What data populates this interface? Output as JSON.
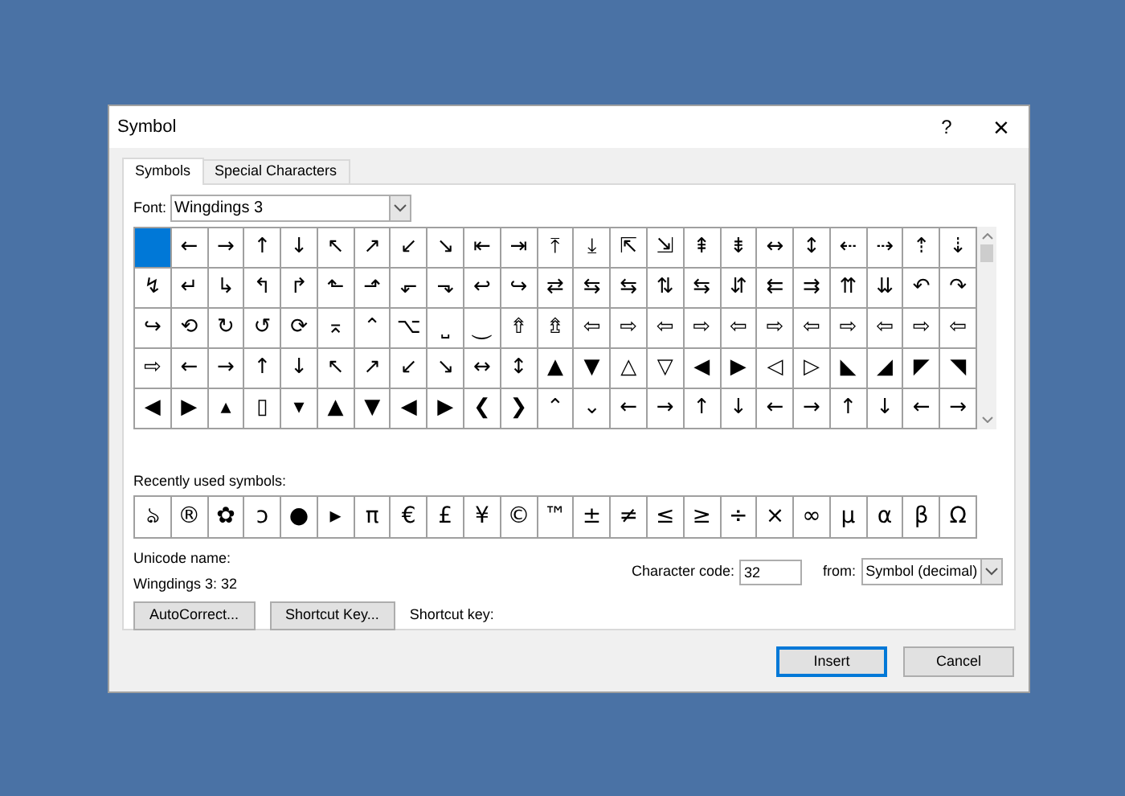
{
  "window": {
    "title": "Symbol",
    "help": "?",
    "close": "×"
  },
  "tabs": [
    {
      "label": "Symbols",
      "selected": true
    },
    {
      "label": "Special Characters",
      "selected": false
    }
  ],
  "font": {
    "label": "Font:",
    "value": "Wingdings 3"
  },
  "grid": {
    "rows": [
      [
        {
          "selected": true
        },
        {
          "symbol": "←",
          "selected": false
        },
        {
          "symbol": "→",
          "selected": false
        },
        {
          "symbol": "↑",
          "selected": false
        },
        {
          "symbol": "↓",
          "selected": false
        },
        {
          "symbol": "↖",
          "selected": false
        },
        {
          "symbol": "↗",
          "selected": false
        },
        {
          "symbol": "↙",
          "selected": false
        },
        {
          "symbol": "↘",
          "selected": false
        },
        {
          "symbol": "⇤",
          "selected": false
        },
        {
          "symbol": "⇥",
          "selected": false
        },
        {
          "symbol": "⤒",
          "selected": false
        },
        {
          "symbol": "⤓",
          "selected": false
        },
        {
          "symbol": "⇱",
          "selected": false
        },
        {
          "symbol": "⇲",
          "selected": false
        },
        {
          "symbol": "⇞",
          "selected": false
        },
        {
          "symbol": "⇟",
          "selected": false
        },
        {
          "symbol": "↔",
          "selected": false
        },
        {
          "symbol": "↕",
          "selected": false
        },
        {
          "symbol": "⇠",
          "selected": false
        },
        {
          "symbol": "⇢",
          "selected": false
        },
        {
          "symbol": "⇡",
          "selected": false
        },
        {
          "symbol": "⇣",
          "selected": false
        }
      ],
      [
        {
          "symbol": "↯",
          "selected": false
        },
        {
          "symbol": "↵",
          "selected": false
        },
        {
          "symbol": "↳",
          "selected": false
        },
        {
          "symbol": "↰",
          "selected": false
        },
        {
          "symbol": "↱",
          "selected": false
        },
        {
          "symbol": "⬑",
          "selected": false
        },
        {
          "symbol": "⬏",
          "selected": false
        },
        {
          "symbol": "⬐",
          "selected": false
        },
        {
          "symbol": "⬎",
          "selected": false
        },
        {
          "symbol": "↩",
          "selected": false
        },
        {
          "symbol": "↪",
          "selected": false
        },
        {
          "symbol": "⇄",
          "selected": false
        },
        {
          "symbol": "⇆",
          "selected": false
        },
        {
          "symbol": "⇆",
          "selected": false
        },
        {
          "symbol": "⇅",
          "selected": false
        },
        {
          "symbol": "⇆",
          "selected": false
        },
        {
          "symbol": "⇵",
          "selected": false
        },
        {
          "symbol": "⇇",
          "selected": false
        },
        {
          "symbol": "⇉",
          "selected": false
        },
        {
          "symbol": "⇈",
          "selected": false
        },
        {
          "symbol": "⇊",
          "selected": false
        },
        {
          "symbol": "↶",
          "selected": false
        },
        {
          "symbol": "↷",
          "selected": false
        }
      ],
      [
        {
          "symbol": "↪",
          "selected": false
        },
        {
          "symbol": "⟲",
          "selected": false
        },
        {
          "symbol": "↻",
          "selected": false
        },
        {
          "symbol": "↺",
          "selected": false
        },
        {
          "symbol": "⟳",
          "selected": false
        },
        {
          "symbol": "⌅",
          "selected": false
        },
        {
          "symbol": "⌃",
          "selected": false
        },
        {
          "symbol": "⌥",
          "selected": false
        },
        {
          "symbol": "⎵",
          "selected": false
        },
        {
          "symbol": "⏝",
          "selected": false
        },
        {
          "symbol": "⇮",
          "selected": false
        },
        {
          "symbol": "⇯",
          "selected": false
        },
        {
          "symbol": "⇦",
          "selected": false
        },
        {
          "symbol": "⇨",
          "selected": false
        },
        {
          "symbol": "⇦",
          "selected": false
        },
        {
          "symbol": "⇨",
          "selected": false
        },
        {
          "symbol": "⇦",
          "selected": false
        },
        {
          "symbol": "⇨",
          "selected": false
        },
        {
          "symbol": "⇦",
          "selected": false
        },
        {
          "symbol": "⇨",
          "selected": false
        },
        {
          "symbol": "⇦",
          "selected": false
        },
        {
          "symbol": "⇨",
          "selected": false
        },
        {
          "symbol": "⇦",
          "selected": false
        }
      ],
      [
        {
          "symbol": "⇨",
          "selected": false
        },
        {
          "symbol": "←",
          "selected": false
        },
        {
          "symbol": "→",
          "selected": false
        },
        {
          "symbol": "↑",
          "selected": false
        },
        {
          "symbol": "↓",
          "selected": false
        },
        {
          "symbol": "↖",
          "selected": false
        },
        {
          "symbol": "↗",
          "selected": false
        },
        {
          "symbol": "↙",
          "selected": false
        },
        {
          "symbol": "↘",
          "selected": false
        },
        {
          "symbol": "↔",
          "selected": false
        },
        {
          "symbol": "↕",
          "selected": false
        },
        {
          "symbol": "▲",
          "selected": false
        },
        {
          "symbol": "▼",
          "selected": false
        },
        {
          "symbol": "△",
          "selected": false
        },
        {
          "symbol": "▽",
          "selected": false
        },
        {
          "symbol": "◀",
          "selected": false
        },
        {
          "symbol": "▶",
          "selected": false
        },
        {
          "symbol": "◁",
          "selected": false
        },
        {
          "symbol": "▷",
          "selected": false
        },
        {
          "symbol": "◣",
          "selected": false
        },
        {
          "symbol": "◢",
          "selected": false
        },
        {
          "symbol": "◤",
          "selected": false
        },
        {
          "symbol": "◥",
          "selected": false
        }
      ],
      [
        {
          "symbol": "◀",
          "selected": false
        },
        {
          "symbol": "▶",
          "selected": false
        },
        {
          "symbol": "▴",
          "selected": false
        },
        {
          "symbol": "▯",
          "selected": false
        },
        {
          "symbol": "▾",
          "selected": false
        },
        {
          "symbol": "▲",
          "selected": false
        },
        {
          "symbol": "▼",
          "selected": false
        },
        {
          "symbol": "◀",
          "selected": false
        },
        {
          "symbol": "▶",
          "selected": false
        },
        {
          "symbol": "❮",
          "selected": false
        },
        {
          "symbol": "❯",
          "selected": false
        },
        {
          "symbol": "⌃",
          "selected": false
        },
        {
          "symbol": "⌄",
          "selected": false
        },
        {
          "symbol": "←",
          "selected": false
        },
        {
          "symbol": "→",
          "selected": false
        },
        {
          "symbol": "↑",
          "selected": false
        },
        {
          "symbol": "↓",
          "selected": false
        },
        {
          "symbol": "←",
          "selected": false
        },
        {
          "symbol": "→",
          "selected": false
        },
        {
          "symbol": "↑",
          "selected": false
        },
        {
          "symbol": "↓",
          "selected": false
        },
        {
          "symbol": "←",
          "selected": false
        },
        {
          "symbol": "→",
          "selected": false
        }
      ]
    ]
  },
  "recent": {
    "label": "Recently used symbols:",
    "symbols": [
      "ঌ",
      "®",
      "✿",
      "ↄ",
      "●",
      "▸",
      "π",
      "€",
      "£",
      "¥",
      "©",
      "™",
      "±",
      "≠",
      "≤",
      "≥",
      "÷",
      "×",
      "∞",
      "µ",
      "α",
      "β",
      "Ω"
    ]
  },
  "unicode_name": {
    "label": "Unicode name:",
    "value": "Wingdings 3: 32"
  },
  "character_code": {
    "label": "Character code:",
    "value": "32"
  },
  "from": {
    "label": "from:",
    "value": "Symbol (decimal)"
  },
  "buttons": [
    {
      "label": "AutoCorrect..."
    },
    {
      "label": "Shortcut Key..."
    }
  ],
  "shortcut": {
    "label": "Shortcut key:"
  },
  "footer": [
    {
      "label": "Insert",
      "default": true
    },
    {
      "label": "Cancel",
      "default": false
    }
  ]
}
